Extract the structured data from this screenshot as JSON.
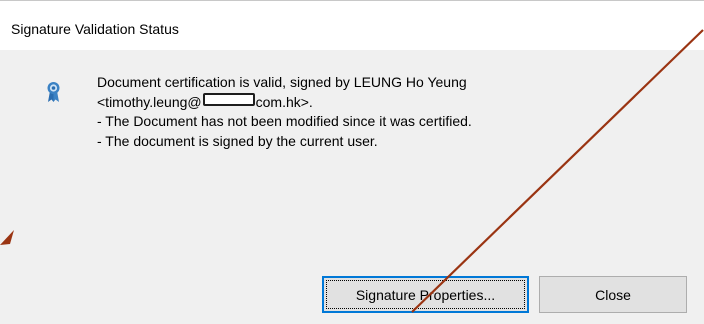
{
  "dialog": {
    "title": "Signature Validation Status",
    "icon": "certificate-ribbon-icon",
    "message": {
      "line1": "Document certification is valid, signed by LEUNG Ho Yeung",
      "email_prefix": "<timothy.leung@",
      "email_suffix": "com.hk>.",
      "line3": "- The Document has not been modified since it was certified.",
      "line4": "- The document is signed by the current user."
    },
    "buttons": {
      "signature_properties": "Signature Properties...",
      "close": "Close"
    }
  },
  "annotations": {
    "arrow_color": "#9a3412"
  },
  "colors": {
    "focus_border": "#0078d7",
    "button_bg": "#e1e1e1",
    "dialog_bg": "#f0f0f0"
  }
}
